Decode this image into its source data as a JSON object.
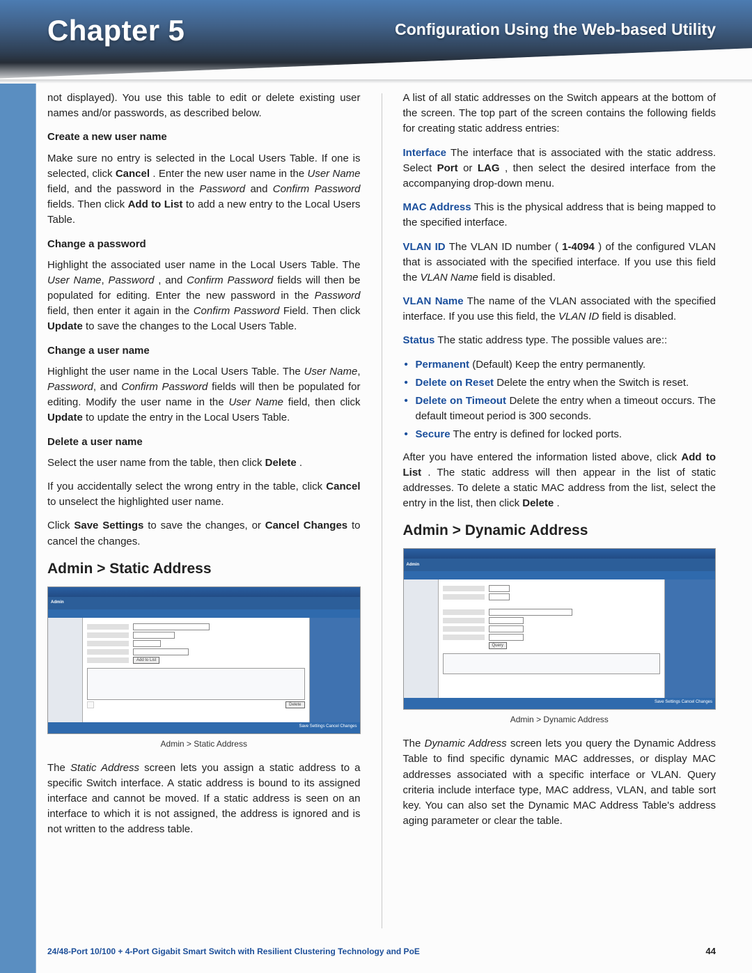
{
  "header": {
    "chapter": "Chapter 5",
    "title": "Configuration Using the Web-based Utility"
  },
  "left": {
    "lead": "not displayed). You use this table to edit or delete existing user names and/or passwords, as described below.",
    "create_h": "Create a new user name",
    "create_p1_a": "Make sure no entry is selected in the Local Users Table. If one is selected, click ",
    "create_p1_b": ". Enter the new user name in the ",
    "create_p1_c": " field, and the password in the ",
    "create_p1_d": " fields. Then click ",
    "create_p1_e": " to add a new entry to the Local Users Table.",
    "w_cancel": "Cancel",
    "w_username": "User Name",
    "w_password": "Password",
    "w_confirm": "Confirm Password",
    "w_addtolist": "Add to List",
    "change_pw_h": "Change a password",
    "change_pw_p_a": "Highlight the associated user name in the Local Users Table. The ",
    "change_pw_p_b": ", and ",
    "change_pw_p_c": " fields will then be populated for editing. Enter the new password in the ",
    "change_pw_p_d": " field, then enter it again in the ",
    "change_pw_p_e": " Field. Then click ",
    "change_pw_p_f": " to save the changes to the Local Users Table.",
    "w_update": "Update",
    "change_un_h": "Change a user name",
    "change_un_p_a": "Highlight the user name in the Local Users Table. The ",
    "change_un_p_b": " fields will then be populated for editing. Modify the user name in the ",
    "change_un_p_c": " field, then click ",
    "change_un_p_d": " to update the entry in the Local Users Table.",
    "delete_un_h": "Delete a user name",
    "delete_un_p1_a": "Select the user name from the table, then click ",
    "delete_un_p1_b": ".",
    "w_delete": "Delete",
    "delete_un_p2_a": "If you accidentally select the wrong entry in the table, click ",
    "delete_un_p2_b": " to unselect the highlighted user name.",
    "delete_un_p3_a": "Click ",
    "w_save": "Save Settings",
    "delete_un_p3_b": " to save the changes, or ",
    "w_cchanges": "Cancel Changes",
    "delete_un_p3_c": " to cancel the changes.",
    "h2_static": "Admin > Static Address",
    "thumb_tab": "Admin",
    "thumb_btn_add": "Add to List",
    "thumb_btn_delete": "Delete",
    "thumb_foot": "Save Settings   Cancel Changes",
    "cap_static": "Admin > Static Address",
    "static_p_a": "The ",
    "w_staticaddr": "Static Address",
    "static_p_b": " screen lets you assign a static address to a specific Switch interface. A static address is bound to its assigned interface and cannot be moved. If a static address is seen on an interface to which it is not assigned, the address is ignored and is not written to the address table."
  },
  "right": {
    "lead": "A list of all static addresses on the Switch appears at the bottom of the screen. The top part of the screen contains the following fields for creating static address entries:",
    "int_lbl": "Interface",
    "int_txt_a": "  The interface that is associated with the static address. Select ",
    "int_txt_b": " or ",
    "int_txt_c": ", then select the desired interface from the accompanying drop-down menu.",
    "w_port": "Port",
    "w_lag": "LAG",
    "mac_lbl": "MAC Address",
    "mac_txt": "  This is the physical address that is being mapped to the specified interface.",
    "vid_lbl": "VLAN ID",
    "vid_txt_a": "  The VLAN ID number (",
    "vid_range": "1-4094",
    "vid_txt_b": ") of the configured VLAN that is associated with the specified interface. If you use this field the ",
    "w_vlanname": "VLAN Name",
    "vid_txt_c": " field is disabled.",
    "vname_lbl": "VLAN Name",
    "vname_txt_a": "  The name of the VLAN associated with the specified interface. If you use this field, the ",
    "w_vlanid": "VLAN ID",
    "vname_txt_b": " field is disabled.",
    "status_lbl": "Status",
    "status_txt": "  The static address type. The possible values are::",
    "b_perm": "Permanent",
    "b_perm_txt": "  (Default) Keep the entry permanently.",
    "b_reset": "Delete on Reset",
    "b_reset_txt": "  Delete the entry when the Switch is reset.",
    "b_to": "Delete on Timeout",
    "b_to_txt": "  Delete the entry when a timeout occurs. The default timeout period is 300 seconds.",
    "b_sec": "Secure",
    "b_sec_txt": "  The entry is defined for locked ports.",
    "after_p_a": "After you have entered the information listed above, click ",
    "w_addlist": "Add to List",
    "after_p_b": ". The static address will then appear in the list of static addresses. To delete a static MAC address from the list, select the entry in the list, then click ",
    "w_delete": "Delete",
    "after_p_c": ".",
    "h2_dyn": "Admin > Dynamic Address",
    "thumb_tab": "Admin",
    "thumb_btn_q": "Query",
    "thumb_foot": "Save Settings   Cancel Changes",
    "cap_dyn": "Admin > Dynamic Address",
    "dyn_p_a": "The ",
    "w_dynaddr": "Dynamic Address",
    "dyn_p_b": " screen lets you query the Dynamic Address Table to find specific dynamic MAC addresses, or display MAC addresses associated with a specific interface or VLAN. Query criteria include interface type, MAC address, VLAN, and table sort key. You can also set the Dynamic MAC Address Table's address aging parameter or clear the table."
  },
  "footer": {
    "product": "24/48-Port 10/100 + 4-Port Gigabit Smart Switch with Resilient Clustering Technology and PoE",
    "page": "44"
  }
}
